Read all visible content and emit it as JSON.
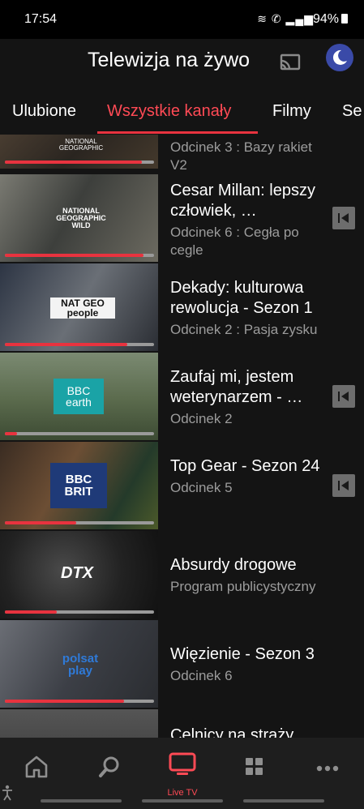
{
  "status": {
    "time": "17:54",
    "battery": "94%"
  },
  "header": {
    "title": "Telewizja na żywo"
  },
  "tabs": [
    "Ulubione",
    "Wszystkie kanały",
    "Filmy",
    "Se"
  ],
  "rows": [
    {
      "channel": "NATIONAL GEOGRAPHIC",
      "title": "",
      "sub": "Odcinek 3 : Bazy rakiet V2",
      "progress": 0.92,
      "replay": false
    },
    {
      "channel": "NATIONAL GEOGRAPHIC WILD",
      "title": "Cesar Millan: lepszy człowiek, …",
      "sub": "Odcinek 6 : Cegła po cegle",
      "progress": 0.93,
      "replay": true
    },
    {
      "channel": "NAT GEO people",
      "title": "Dekady: kulturowa rewolucja - Sezon 1",
      "sub": "Odcinek 2 : Pasja zysku",
      "progress": 0.82,
      "replay": false
    },
    {
      "channel": "BBC earth",
      "title": "Zaufaj mi, jestem weterynarzem - …",
      "sub": "Odcinek 2",
      "progress": 0.08,
      "replay": true
    },
    {
      "channel": "BBC BRIT",
      "title": "Top Gear - Sezon 24",
      "sub": "Odcinek 5",
      "progress": 0.48,
      "replay": true
    },
    {
      "channel": "DTX",
      "title": "Absurdy drogowe",
      "sub": "Program publicystyczny",
      "progress": 0.35,
      "replay": false
    },
    {
      "channel": "polsat play",
      "title": "Więzienie - Sezon 3",
      "sub": "Odcinek 6",
      "progress": 0.8,
      "replay": false
    },
    {
      "channel": "",
      "title": "Celnicy na straży",
      "sub": "",
      "progress": 0,
      "replay": false
    }
  ],
  "bottom_nav": {
    "live_tv_label": "Live TV"
  },
  "colors": {
    "accent": "#e8333f",
    "background": "#141414"
  }
}
